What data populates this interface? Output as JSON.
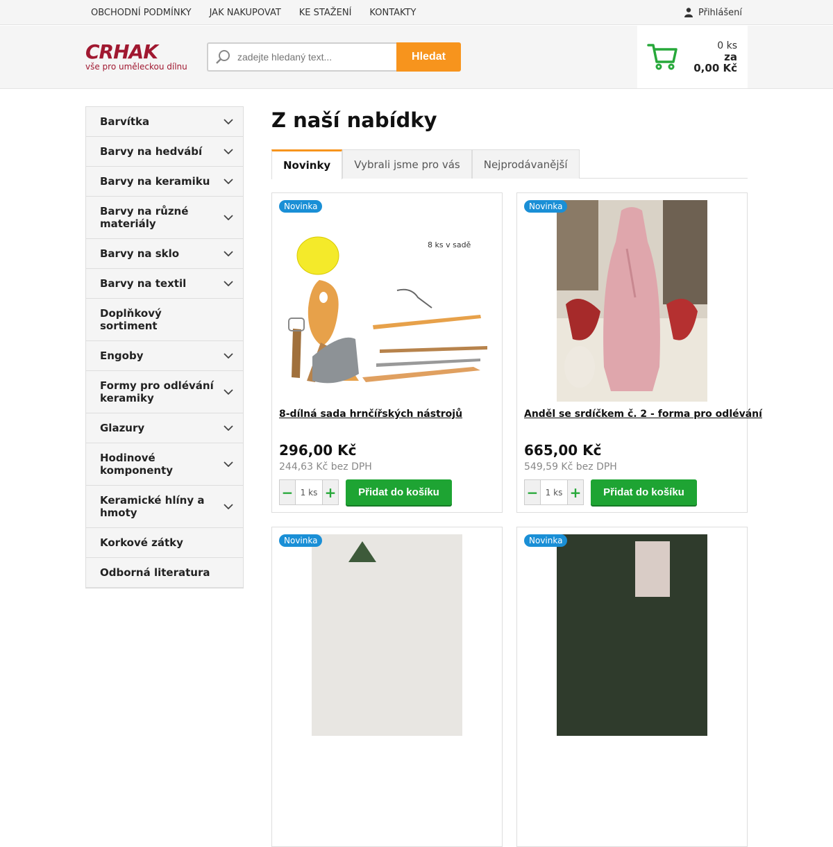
{
  "topnav": {
    "items": [
      "OBCHODNÍ PODMÍNKY",
      "JAK NAKUPOVAT",
      "KE STAŽENÍ",
      "KONTAKTY"
    ],
    "login_label": "Přihlášení"
  },
  "logo": {
    "main": "CRHAK",
    "tagline": "vše pro uměleckou dílnu"
  },
  "search": {
    "placeholder": "zadejte hledaný text...",
    "button_label": "Hledat"
  },
  "cart": {
    "count": "0 ks",
    "label": "za",
    "total": "0,00 Kč"
  },
  "sidebar": {
    "items": [
      {
        "label": "Barvítka",
        "expandable": true
      },
      {
        "label": "Barvy na hedvábí",
        "expandable": true
      },
      {
        "label": "Barvy na keramiku",
        "expandable": true
      },
      {
        "label": "Barvy na různé materiály",
        "expandable": true
      },
      {
        "label": "Barvy na sklo",
        "expandable": true
      },
      {
        "label": "Barvy na textil",
        "expandable": true
      },
      {
        "label": "Doplňkový sortiment",
        "expandable": false
      },
      {
        "label": "Engoby",
        "expandable": true
      },
      {
        "label": "Formy pro odlévání keramiky",
        "expandable": true
      },
      {
        "label": "Glazury",
        "expandable": true
      },
      {
        "label": "Hodinové komponenty",
        "expandable": true
      },
      {
        "label": "Keramické hlíny a hmoty",
        "expandable": true
      },
      {
        "label": "Korkové zátky",
        "expandable": false
      },
      {
        "label": "Odborná literatura",
        "expandable": false
      }
    ]
  },
  "main": {
    "title": "Z naší nabídky",
    "tabs": [
      {
        "label": "Novinky",
        "active": true
      },
      {
        "label": "Vybrali jsme pro vás",
        "active": false
      },
      {
        "label": "Nejprodávanější",
        "active": false
      }
    ],
    "products": [
      {
        "badge": "Novinka",
        "name": "8-dílná sada hrnčířských nástrojů",
        "price": "296,00 Kč",
        "price_net": "244,63 Kč bez DPH",
        "qty": "1 ks",
        "add_label": "Přidat do košíku",
        "image_text": "8 ks v sadě"
      },
      {
        "badge": "Novinka",
        "name": "Anděl se srdíčkem č. 2 - forma pro odlévání",
        "price": "665,00 Kč",
        "price_net": "549,59 Kč bez DPH",
        "qty": "1 ks",
        "add_label": "Přidat do košíku"
      },
      {
        "badge": "Novinka"
      },
      {
        "badge": "Novinka"
      }
    ]
  },
  "colors": {
    "accent_orange": "#f7941d",
    "brand_red": "#a01830",
    "cart_green": "#27a83a",
    "button_green": "#1ea433",
    "badge_blue": "#1a8fd6"
  }
}
